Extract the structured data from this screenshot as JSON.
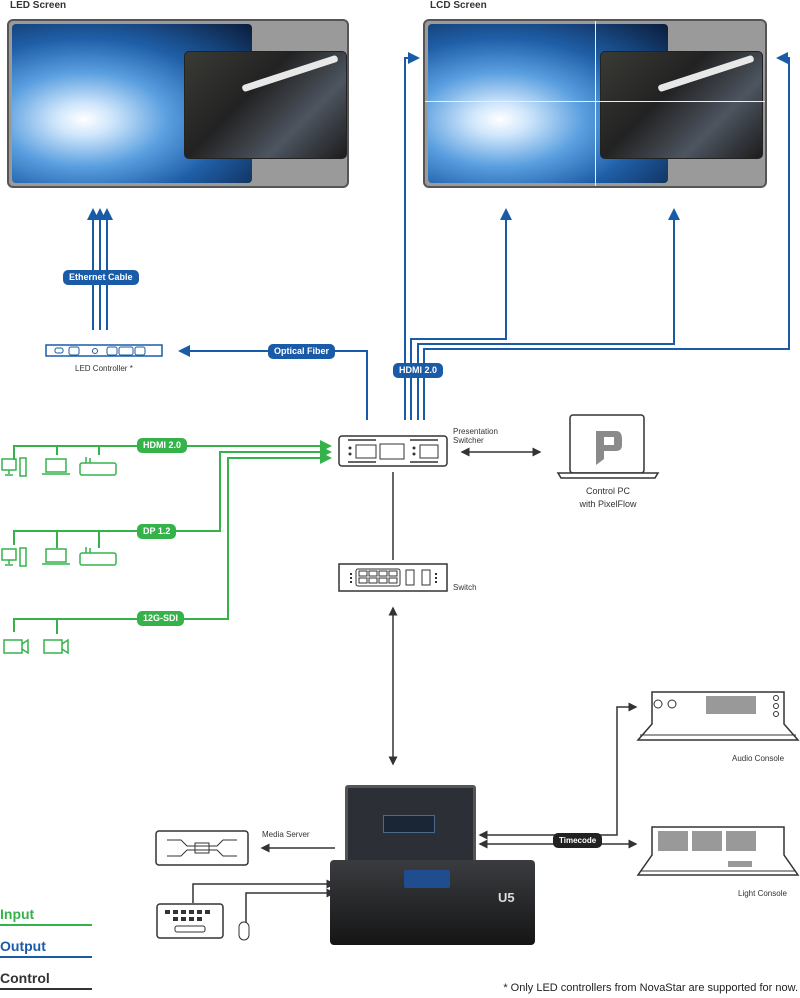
{
  "screens": {
    "led": {
      "title": "LED Screen"
    },
    "lcd": {
      "title": "LCD Screen"
    }
  },
  "devices": {
    "led_controller": "LED Controller *",
    "presentation_switcher": [
      "Presentation",
      "Switcher"
    ],
    "control_pc": [
      "Control PC",
      "with PixelFlow"
    ],
    "switch": "Switch",
    "media_server": "Media Server",
    "audio_console": "Audio Console",
    "light_console": "Light Console"
  },
  "connections": {
    "ethernet": "Ethernet Cable",
    "optical": "Optical Fiber",
    "hdmi_out": "HDMI 2.0",
    "hdmi_in": "HDMI 2.0",
    "dp": "DP 1.2",
    "sdi": "12G-SDI",
    "timecode": "Timecode"
  },
  "legend": [
    {
      "label": "Input",
      "color": "#35b34a"
    },
    {
      "label": "Output",
      "color": "#1a5ba8"
    },
    {
      "label": "Control",
      "color": "#333333"
    }
  ],
  "colors": {
    "input": "#35b34a",
    "output": "#1a5ba8",
    "control": "#333333"
  },
  "footnote": "* Only LED controllers from NovaStar are supported for now.",
  "u5_label": "U5"
}
